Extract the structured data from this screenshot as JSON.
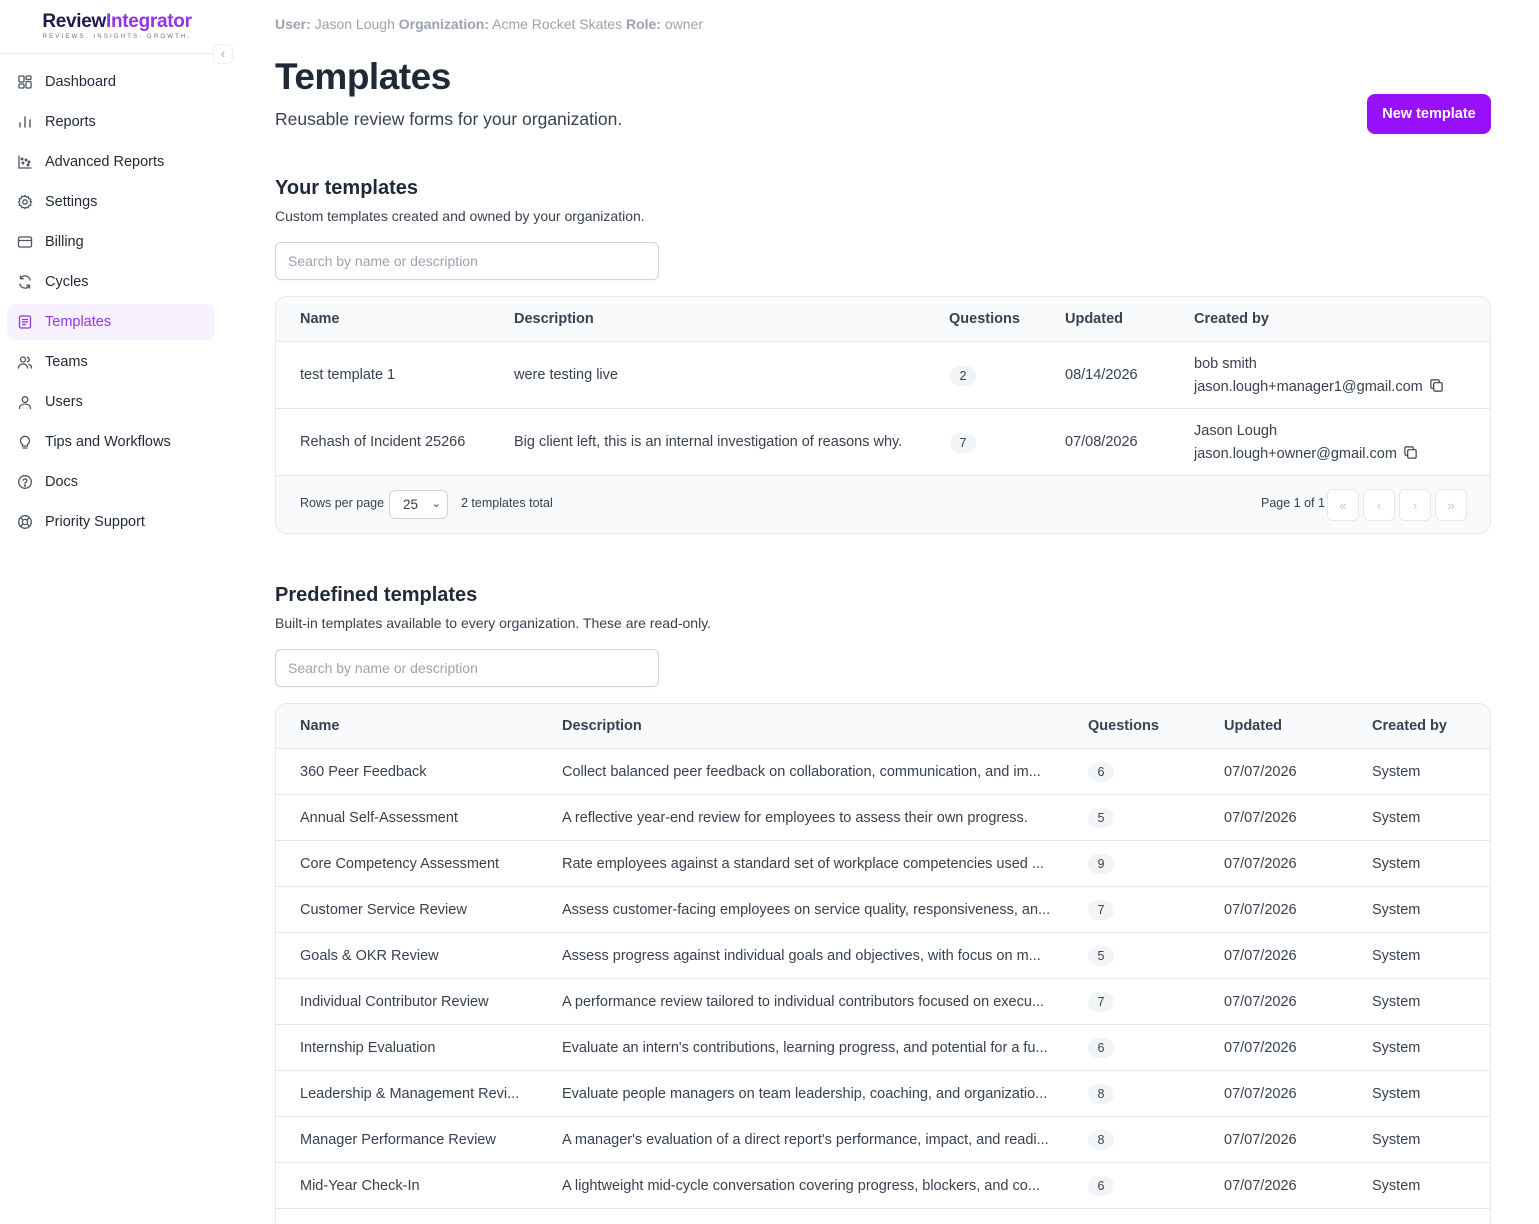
{
  "brand": {
    "name_part1": "Review",
    "name_part2": "Integrator",
    "tagline": "REVIEWS. INSIGHTS. GROWTH."
  },
  "sidebar": {
    "collapse_glyph": "‹",
    "items": [
      {
        "label": "Dashboard",
        "icon": "dashboard-icon",
        "active": false
      },
      {
        "label": "Reports",
        "icon": "bar-chart-icon",
        "active": false
      },
      {
        "label": "Advanced Reports",
        "icon": "scatter-chart-icon",
        "active": false
      },
      {
        "label": "Settings",
        "icon": "gear-icon",
        "active": false
      },
      {
        "label": "Billing",
        "icon": "credit-card-icon",
        "active": false
      },
      {
        "label": "Cycles",
        "icon": "refresh-icon",
        "active": false
      },
      {
        "label": "Templates",
        "icon": "template-icon",
        "active": true
      },
      {
        "label": "Teams",
        "icon": "users-group-icon",
        "active": false
      },
      {
        "label": "Users",
        "icon": "user-icon",
        "active": false
      },
      {
        "label": "Tips and Workflows",
        "icon": "lightbulb-icon",
        "active": false
      },
      {
        "label": "Docs",
        "icon": "help-circle-icon",
        "active": false
      },
      {
        "label": "Priority Support",
        "icon": "lifebuoy-icon",
        "active": false
      }
    ]
  },
  "context": {
    "user_label": "User:",
    "user": "Jason Lough",
    "org_label": "Organization:",
    "org": "Acme Rocket Skates",
    "role_label": "Role:",
    "role": "owner"
  },
  "page": {
    "title": "Templates",
    "subtitle": "Reusable review forms for your organization.",
    "new_button": "New template"
  },
  "your_templates": {
    "title": "Your templates",
    "description": "Custom templates created and owned by your organization.",
    "search_placeholder": "Search by name or description",
    "columns": {
      "name": "Name",
      "description": "Description",
      "questions": "Questions",
      "updated": "Updated",
      "created_by": "Created by"
    },
    "rows": [
      {
        "name": "test template 1",
        "description": "were testing live",
        "questions": "2",
        "updated": "08/14/2026",
        "creator_name": "bob smith",
        "creator_email": "jason.lough+manager1@gmail.com"
      },
      {
        "name": "Rehash of Incident 25266",
        "description": "Big client left, this is an internal investigation of reasons why.",
        "questions": "7",
        "updated": "07/08/2026",
        "creator_name": "Jason Lough",
        "creator_email": "jason.lough+owner@gmail.com"
      }
    ],
    "footer": {
      "rows_per_page_label": "Rows per page",
      "rows_per_page": "25",
      "total": "2 templates total",
      "page": "Page 1 of 1",
      "first": "«",
      "prev": "‹",
      "next": "›",
      "last": "»"
    }
  },
  "predefined_templates": {
    "title": "Predefined templates",
    "description": "Built-in templates available to every organization. These are read-only.",
    "search_placeholder": "Search by name or description",
    "columns": {
      "name": "Name",
      "description": "Description",
      "questions": "Questions",
      "updated": "Updated",
      "created_by": "Created by"
    },
    "rows": [
      {
        "name": "360 Peer Feedback",
        "description": "Collect balanced peer feedback on collaboration, communication, and im...",
        "questions": "6",
        "updated": "07/07/2026",
        "created_by": "System"
      },
      {
        "name": "Annual Self-Assessment",
        "description": "A reflective year-end review for employees to assess their own progress.",
        "questions": "5",
        "updated": "07/07/2026",
        "created_by": "System"
      },
      {
        "name": "Core Competency Assessment",
        "description": "Rate employees against a standard set of workplace competencies used ...",
        "questions": "9",
        "updated": "07/07/2026",
        "created_by": "System"
      },
      {
        "name": "Customer Service Review",
        "description": "Assess customer-facing employees on service quality, responsiveness, an...",
        "questions": "7",
        "updated": "07/07/2026",
        "created_by": "System"
      },
      {
        "name": "Goals & OKR Review",
        "description": "Assess progress against individual goals and objectives, with focus on m...",
        "questions": "5",
        "updated": "07/07/2026",
        "created_by": "System"
      },
      {
        "name": "Individual Contributor Review",
        "description": "A performance review tailored to individual contributors focused on execu...",
        "questions": "7",
        "updated": "07/07/2026",
        "created_by": "System"
      },
      {
        "name": "Internship Evaluation",
        "description": "Evaluate an intern's contributions, learning progress, and potential for a fu...",
        "questions": "6",
        "updated": "07/07/2026",
        "created_by": "System"
      },
      {
        "name": "Leadership & Management Revi...",
        "description": "Evaluate people managers on team leadership, coaching, and organizatio...",
        "questions": "8",
        "updated": "07/07/2026",
        "created_by": "System"
      },
      {
        "name": "Manager Performance Review",
        "description": "A manager's evaluation of a direct report's performance, impact, and readi...",
        "questions": "8",
        "updated": "07/07/2026",
        "created_by": "System"
      },
      {
        "name": "Mid-Year Check-In",
        "description": "A lightweight mid-cycle conversation covering progress, blockers, and co...",
        "questions": "6",
        "updated": "07/07/2026",
        "created_by": "System"
      }
    ]
  },
  "colors": {
    "accent": "#9810fa",
    "active_bg": "#f7f2fe",
    "active_text": "#9333ea"
  }
}
